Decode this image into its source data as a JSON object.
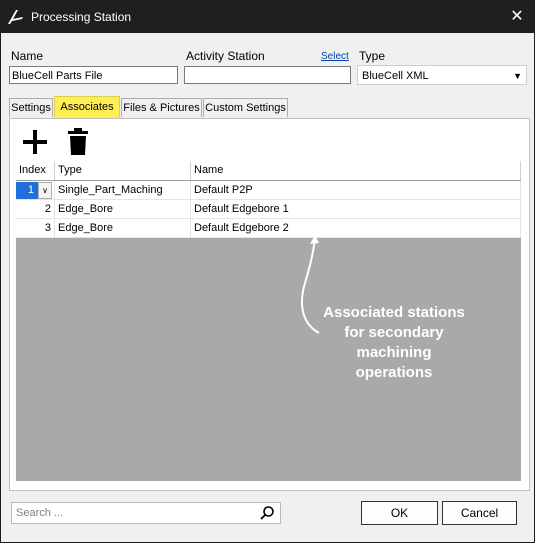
{
  "window": {
    "title": "Processing Station",
    "close_symbol": "✕"
  },
  "form": {
    "name_label": "Name",
    "name_value": "BlueCell Parts File",
    "activity_label": "Activity Station",
    "activity_value": "",
    "select_link": "Select",
    "type_label": "Type",
    "type_value": "BlueCell XML"
  },
  "tabs": [
    {
      "label": "Settings"
    },
    {
      "label": "Associates",
      "active": true
    },
    {
      "label": "Files & Pictures"
    },
    {
      "label": "Custom Settings"
    }
  ],
  "toolbar": {
    "add_icon": "plus-icon",
    "delete_icon": "trash-icon"
  },
  "grid": {
    "columns": [
      "Index",
      "Type",
      "Name"
    ],
    "rows": [
      {
        "index": "1",
        "type": "Single_Part_Maching",
        "name": "Default P2P",
        "selected": true
      },
      {
        "index": "2",
        "type": "Edge_Bore",
        "name": "Default Edgebore 1"
      },
      {
        "index": "3",
        "type": "Edge_Bore",
        "name": "Default Edgebore 2"
      }
    ]
  },
  "annotation": {
    "line1": "Associated stations",
    "line2": "for secondary",
    "line3": "machining",
    "line4": "operations"
  },
  "footer": {
    "search_placeholder": "Search ...",
    "ok_label": "OK",
    "cancel_label": "Cancel"
  },
  "colors": {
    "titlebar": "#1f1f1f",
    "active_tab": "#ffef55",
    "selection": "#1e6fd9",
    "grid_empty": "#a9a9a9"
  }
}
